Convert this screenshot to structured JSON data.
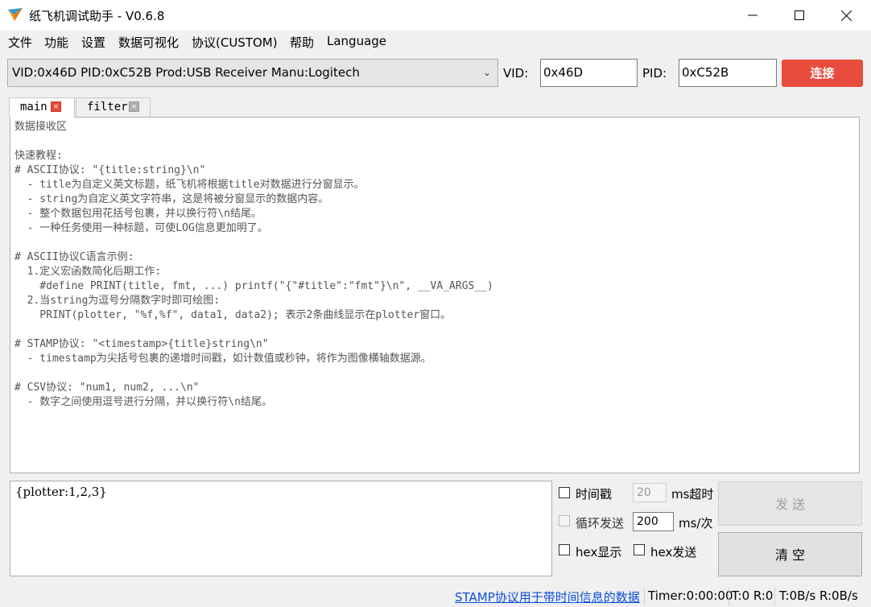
{
  "window": {
    "title": "纸飞机调试助手 - V0.6.8"
  },
  "menu": [
    "文件",
    "功能",
    "设置",
    "数据可视化",
    "协议(CUSTOM)",
    "帮助",
    "Language"
  ],
  "device": {
    "selected": "VID:0x46D PID:0xC52B Prod:USB Receiver Manu:Logitech",
    "vid_label": "VID:",
    "vid_value": "0x46D",
    "pid_label": "PID:",
    "pid_value": "0xC52B",
    "connect_label": "连接",
    "connect_color": "#e74c3c"
  },
  "tabs": [
    {
      "label": "main",
      "close_icon": "close-icon",
      "close_color": "#e74c3c"
    },
    {
      "label": "filter",
      "close_icon": "close-icon",
      "close_color": "#a8a8a8"
    }
  ],
  "receive": {
    "text": "数据接收区\n\n快速教程:\n# ASCII协议: \"{title:string}\\n\"\n  - title为自定义英文标题，纸飞机将根据title对数据进行分窗显示。\n  - string为自定义英文字符串，这是将被分窗显示的数据内容。\n  - 整个数据包用花括号包裹，并以换行符\\n结尾。\n  - 一种任务使用一种标题，可使LOG信息更加明了。\n\n# ASCII协议C语言示例:\n  1.定义宏函数简化后期工作:\n    #define PRINT(title, fmt, ...) printf(\"{\"#title\":\"fmt\"}\\n\", __VA_ARGS__)\n  2.当string为逗号分隔数字时即可绘图:\n    PRINT(plotter, \"%f,%f\", data1, data2); 表示2条曲线显示在plotter窗口。\n\n# STAMP协议: \"<timestamp>{title}string\\n\"\n  - timestamp为尖括号包裹的递增时间戳，如计数值或秒钟，将作为图像横轴数据源。\n\n# CSV协议: \"num1, num2, ...\\n\"\n  - 数字之间使用逗号进行分隔，并以换行符\\n结尾。"
  },
  "send": {
    "input_value": "{plotter:1,2,3}",
    "timestamp_label": "时间戳",
    "timeout_value": "20",
    "timeout_unit": "ms超时",
    "loop_label": "循环发送",
    "interval_value": "200",
    "interval_unit": "ms/次",
    "hex_display_label": "hex显示",
    "hex_send_label": "hex发送",
    "send_button": "发 送",
    "clear_button": "清 空"
  },
  "status": {
    "link": "STAMP协议用于带时间信息的数据",
    "timer": "Timer:0:00:00",
    "counts": "T:0 R:0",
    "rates": "T:0B/s R:0B/s"
  }
}
